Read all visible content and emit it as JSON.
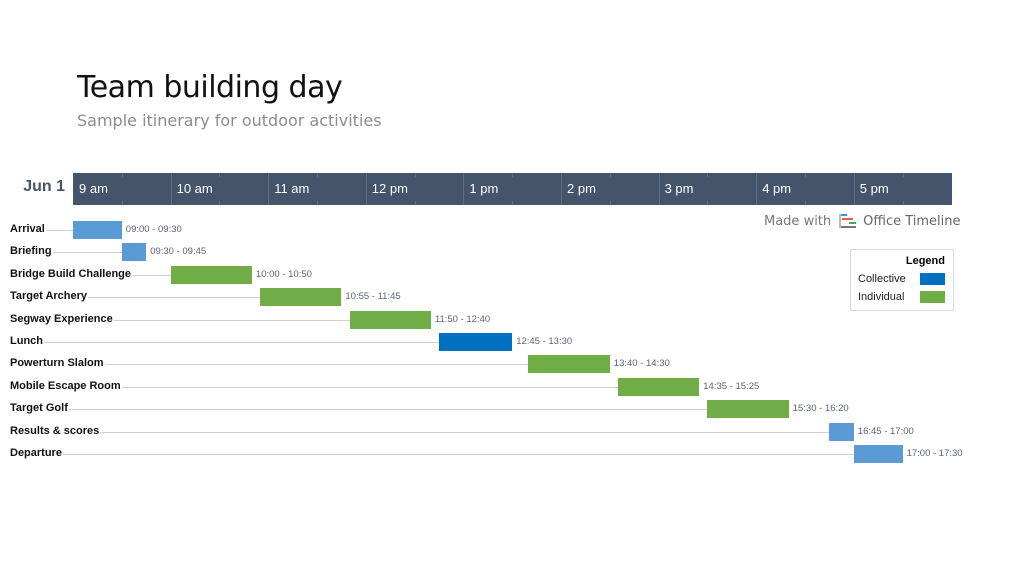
{
  "header": {
    "title": "Team building day",
    "subtitle": "Sample itinerary for outdoor activities"
  },
  "watermark": {
    "prefix": "Made with",
    "brand": "Office Timeline",
    "icon": "office-timeline-logo-icon"
  },
  "colors": {
    "band": "#44546a",
    "collective": "#0070c0",
    "collective_light": "#5b9bd5",
    "individual": "#70ad47"
  },
  "chart_data": {
    "type": "gantt",
    "title": "Team building day",
    "subtitle": "Sample itinerary for outdoor activities",
    "date_label": "Jun 1",
    "x_range": [
      "09:00",
      "18:00"
    ],
    "hour_ticks": [
      "9 am",
      "10 am",
      "11 am",
      "12 pm",
      "1 pm",
      "2 pm",
      "3 pm",
      "4 pm",
      "5 pm"
    ],
    "legend": {
      "title": "Legend",
      "placement": "right",
      "items": [
        {
          "label": "Collective",
          "color": "#0070c0"
        },
        {
          "label": "Individual",
          "color": "#70ad47"
        }
      ]
    },
    "tasks": [
      {
        "name": "Arrival",
        "start": "09:00",
        "end": "09:30",
        "label": "09:00 - 09:30",
        "color": "#5b9bd5"
      },
      {
        "name": "Briefing",
        "start": "09:30",
        "end": "09:45",
        "label": "09:30 - 09:45",
        "color": "#5b9bd5"
      },
      {
        "name": "Bridge Build Challenge",
        "start": "10:00",
        "end": "10:50",
        "label": "10:00 - 10:50",
        "color": "#70ad47"
      },
      {
        "name": "Target Archery",
        "start": "10:55",
        "end": "11:45",
        "label": "10:55 - 11:45",
        "color": "#70ad47"
      },
      {
        "name": "Segway Experience",
        "start": "11:50",
        "end": "12:40",
        "label": "11:50 - 12:40",
        "color": "#70ad47"
      },
      {
        "name": "Lunch",
        "start": "12:45",
        "end": "13:30",
        "label": "12:45 - 13:30",
        "color": "#0070c0"
      },
      {
        "name": "Powerturn Slalom",
        "start": "13:40",
        "end": "14:30",
        "label": "13:40 - 14:30",
        "color": "#70ad47"
      },
      {
        "name": "Mobile Escape Room",
        "start": "14:35",
        "end": "15:25",
        "label": "14:35 - 15:25",
        "color": "#70ad47"
      },
      {
        "name": "Target Golf",
        "start": "15:30",
        "end": "16:20",
        "label": "15:30 - 16:20",
        "color": "#70ad47"
      },
      {
        "name": "Results & scores",
        "start": "16:45",
        "end": "17:00",
        "label": "16:45 - 17:00",
        "color": "#5b9bd5"
      },
      {
        "name": "Departure",
        "start": "17:00",
        "end": "17:30",
        "label": "17:00 - 17:30",
        "color": "#5b9bd5"
      }
    ]
  }
}
